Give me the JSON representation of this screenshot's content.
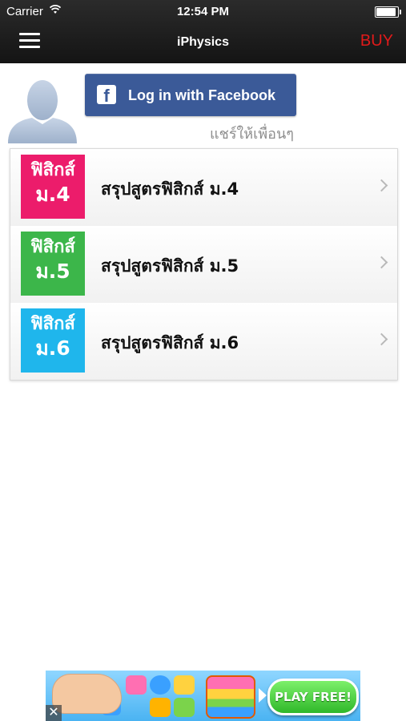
{
  "status_bar": {
    "carrier": "Carrier",
    "time": "12:54 PM"
  },
  "nav": {
    "title": "iPhysics",
    "buy_label": "BUY",
    "menu_icon": "hamburger-menu-icon"
  },
  "profile": {
    "avatar_icon": "default-avatar-icon",
    "facebook_button_label": "Log in with Facebook",
    "share_text": "แชร์ให้เพื่อนๆ"
  },
  "courses": [
    {
      "thumb_line1": "ฟิสิกส์",
      "thumb_line2": "ม.4",
      "label": "สรุปสูตรฟิสิกส์ ม.4",
      "color": "#ec1c6b"
    },
    {
      "thumb_line1": "ฟิสิกส์",
      "thumb_line2": "ม.5",
      "label": "สรุปสูตรฟิสิกส์ ม.5",
      "color": "#3cb64a"
    },
    {
      "thumb_line1": "ฟิสิกส์",
      "thumb_line2": "ม.6",
      "label": "สรุปสูตรฟิสิกส์ ม.6",
      "color": "#1fb6ec"
    }
  ],
  "ad": {
    "cta_label": "PLAY FREE!",
    "close_label": "✕"
  },
  "colors": {
    "nav_bg": "#1c1c1c",
    "buy": "#e01a1a",
    "facebook": "#3b5a98"
  }
}
